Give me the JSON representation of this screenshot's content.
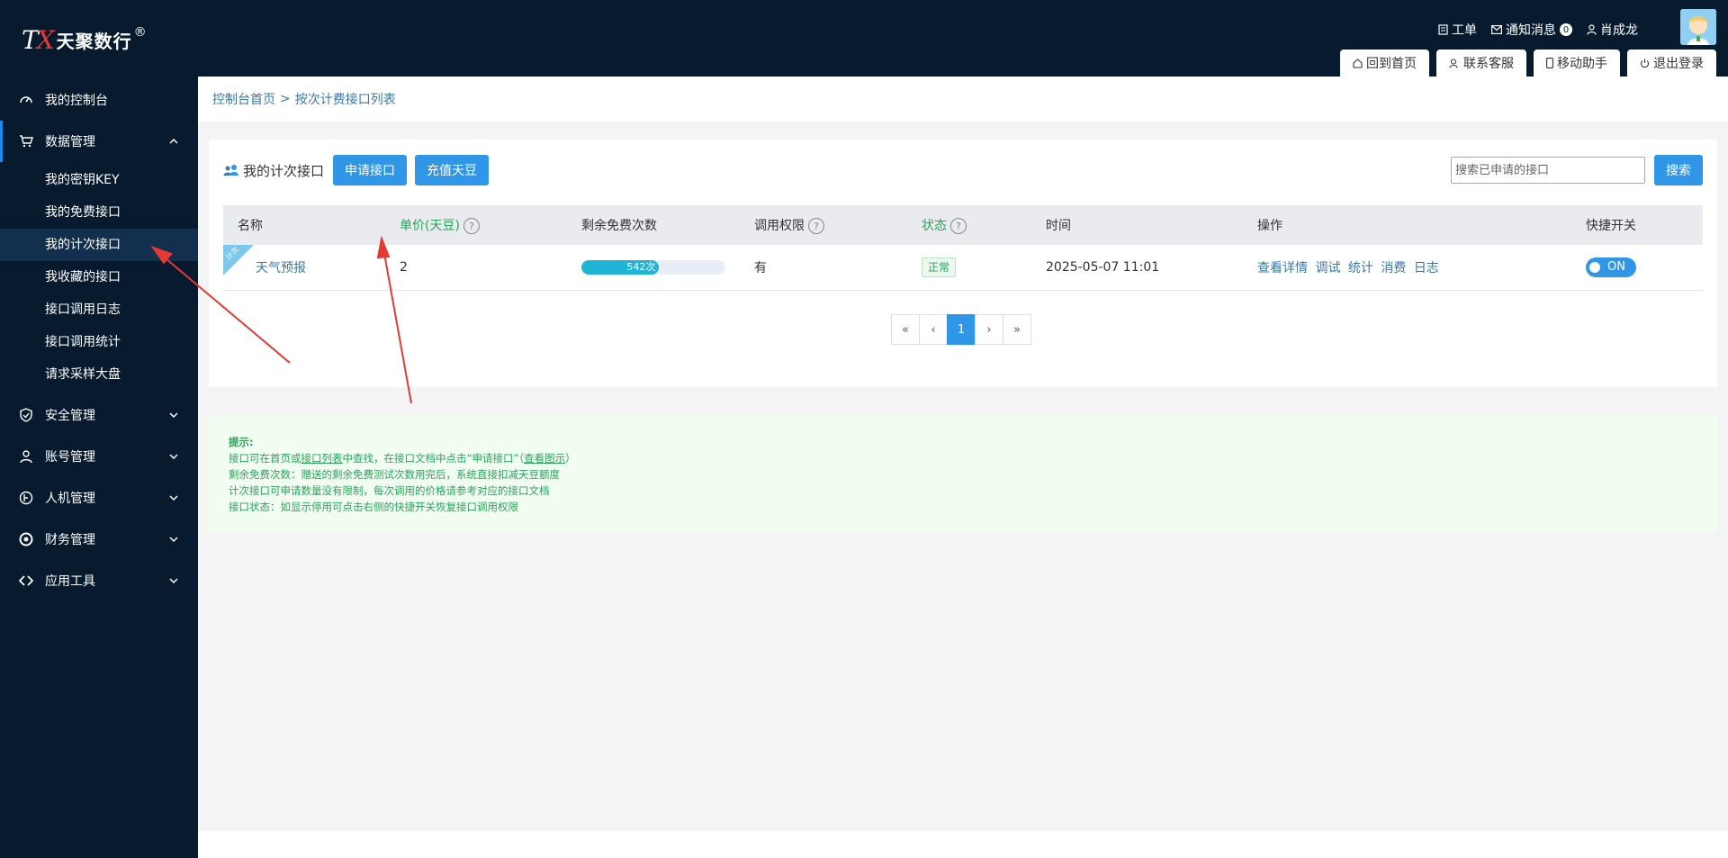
{
  "brand": {
    "mark": "TX",
    "name": "天聚数行",
    "reg": "®"
  },
  "sidebar": {
    "items": [
      {
        "label": "我的控制台",
        "icon": "dashboard-icon"
      },
      {
        "label": "数据管理",
        "icon": "cart-icon",
        "open": true,
        "children": [
          "我的密钥KEY",
          "我的免费接口",
          "我的计次接口",
          "我收藏的接口",
          "接口调用日志",
          "接口调用统计",
          "请求采样大盘"
        ],
        "active_child": "我的计次接口"
      },
      {
        "label": "安全管理",
        "icon": "shield-icon"
      },
      {
        "label": "账号管理",
        "icon": "user-icon"
      },
      {
        "label": "人机管理",
        "icon": "robot-icon"
      },
      {
        "label": "财务管理",
        "icon": "finance-icon"
      },
      {
        "label": "应用工具",
        "icon": "code-icon"
      }
    ]
  },
  "header": {
    "links": {
      "ticket": "工单",
      "notice": "通知消息",
      "notice_count": "0",
      "user": "肖成龙"
    },
    "tabs": {
      "home": "回到首页",
      "service": "联系客服",
      "mobile": "移动助手",
      "logout": "退出登录"
    }
  },
  "breadcrumb": {
    "home": "控制台首页",
    "sep": ">",
    "current": "按次计费接口列表"
  },
  "panel": {
    "title": "我的计次接口",
    "apply_btn": "申请接口",
    "recharge_btn": "充值天豆",
    "search_placeholder": "搜索已申请的接口",
    "search_btn": "搜索"
  },
  "table": {
    "headers": {
      "name": "名称",
      "price": "单价(天豆)",
      "remaining": "剩余免费次数",
      "permission": "调用权限",
      "status": "状态",
      "time": "时间",
      "ops": "操作",
      "switch": "快捷开关"
    },
    "rows": [
      {
        "corner": "计次",
        "name": "天气预报",
        "price": "2",
        "remaining_label": "542次",
        "remaining_fraction": 0.54,
        "permission": "有",
        "status": "正常",
        "time": "2025-05-07 11:01",
        "ops": [
          "查看详情",
          "调试",
          "统计",
          "消费",
          "日志"
        ],
        "switch": "ON"
      }
    ],
    "help_mark": "?"
  },
  "pager": {
    "first": "«",
    "prev": "‹",
    "current": "1",
    "next": "›",
    "last": "»"
  },
  "tip": {
    "title": "提示:",
    "line1_a": "接口可在首页或",
    "line1_link": "接口列表",
    "line1_b": "中查找，在接口文档中点击“申请接口”（",
    "line1_link2": "查看图示",
    "line1_c": "）",
    "line2": "剩余免费次数：赠送的剩余免费测试次数用完后，系统直接扣减天豆额度",
    "line3": "计次接口可申请数量没有限制，每次调用的价格请参考对应的接口文档",
    "line4": "接口状态：如显示停用可点击右侧的快捷开关恢复接口调用权限"
  },
  "colors": {
    "sidebar_bg": "#071a2e",
    "accent": "#2f96e8",
    "green": "#2aa45b",
    "annotation_arrow": "#e53935"
  }
}
